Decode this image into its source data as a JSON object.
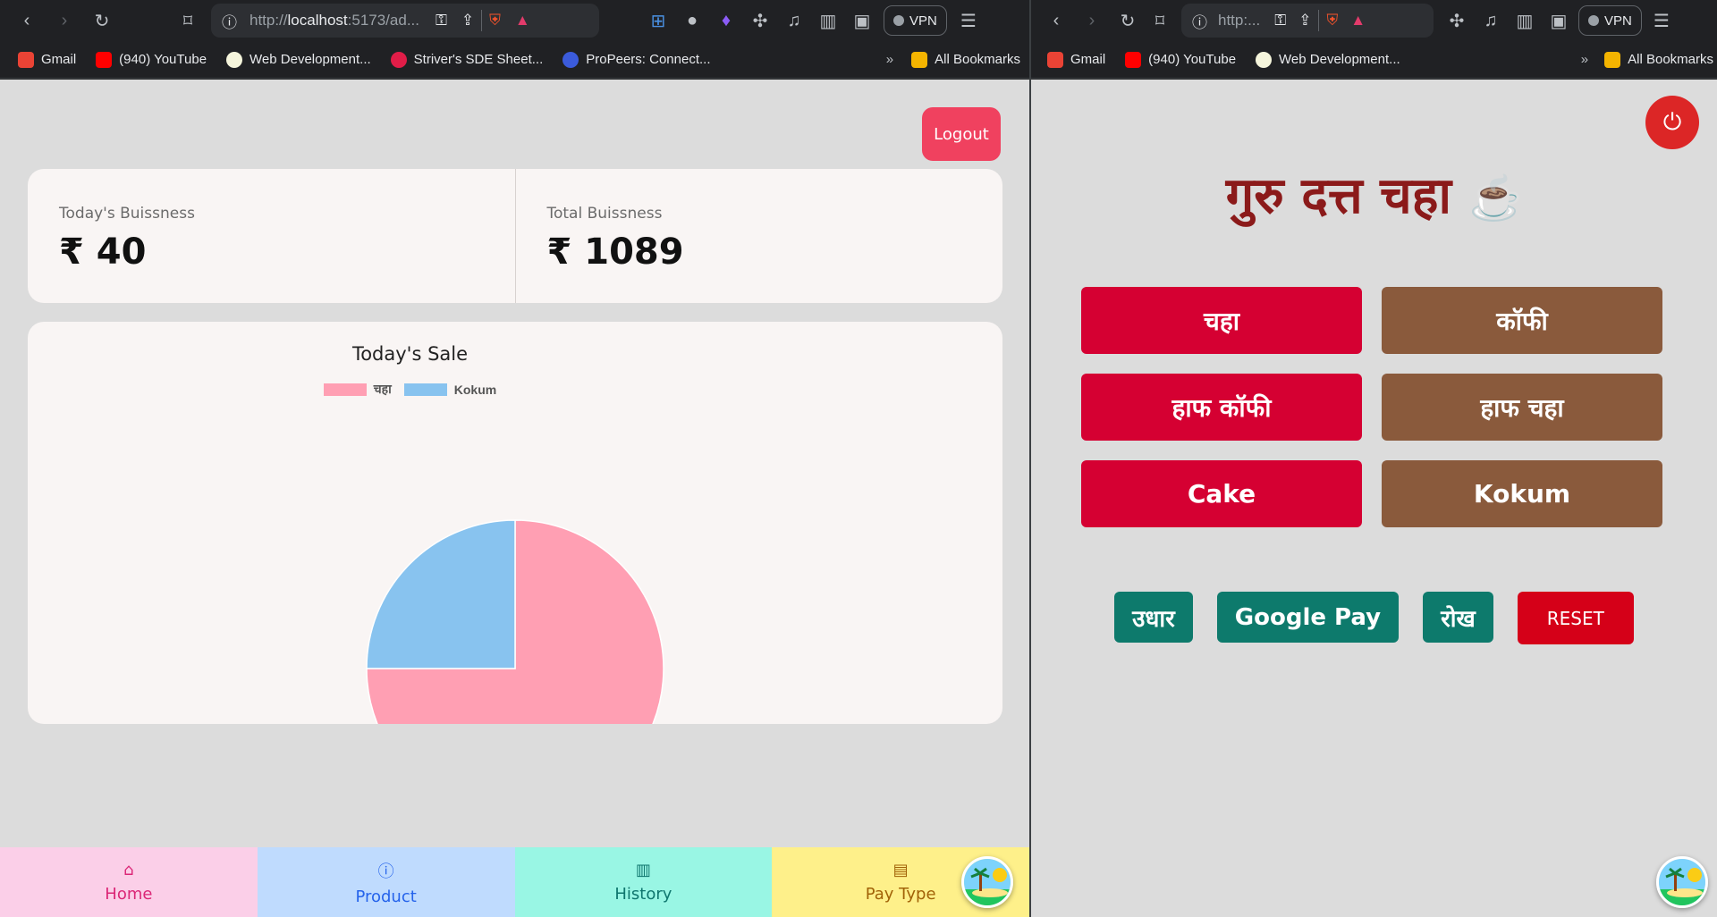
{
  "left_browser": {
    "url_prefix": "http://",
    "url_host": "localhost",
    "url_rest": ":5173/ad...",
    "vpn_label": "VPN",
    "bookmarks": [
      {
        "label": "Gmail",
        "icon": "gmail-icon"
      },
      {
        "label": "(940) YouTube",
        "icon": "youtube-icon"
      },
      {
        "label": "Web Development...",
        "icon": "web-dev-icon"
      },
      {
        "label": "Striver's SDE Sheet...",
        "icon": "tuf-icon"
      },
      {
        "label": "ProPeers: Connect...",
        "icon": "propeers-icon"
      }
    ],
    "overflow": "»",
    "all_bookmarks": "All Bookmarks"
  },
  "right_browser": {
    "url_text": "http:...",
    "vpn_label": "VPN",
    "bookmarks": [
      {
        "label": "Gmail",
        "icon": "gmail-icon"
      },
      {
        "label": "(940) YouTube",
        "icon": "youtube-icon"
      },
      {
        "label": "Web Development...",
        "icon": "web-dev-icon"
      }
    ],
    "overflow": "»",
    "all_bookmarks": "All Bookmarks"
  },
  "admin": {
    "logout_label": "Logout",
    "today_label": "Today's Buissness",
    "today_value": "₹ 40",
    "total_label": "Total Buissness",
    "total_value": "₹ 1089",
    "nav": [
      {
        "label": "Home",
        "icon": "home-icon"
      },
      {
        "label": "Product",
        "icon": "info-icon"
      },
      {
        "label": "History",
        "icon": "bar-chart-icon"
      },
      {
        "label": "Pay Type",
        "icon": "money-icon"
      }
    ]
  },
  "chart_data": {
    "type": "pie",
    "title": "Today's Sale",
    "legend_position": "top",
    "categories": [
      "चहा",
      "Kokum"
    ],
    "values": [
      30,
      10
    ],
    "colors": [
      "#ff9fb3",
      "#88c3ef"
    ]
  },
  "pos": {
    "brand_title": "गुरु दत्त चहा",
    "brand_icon": "☕",
    "items": [
      {
        "label": "चहा",
        "color": "red"
      },
      {
        "label": "कॉफी",
        "color": "brown"
      },
      {
        "label": "हाफ कॉफी",
        "color": "red"
      },
      {
        "label": "हाफ चहा",
        "color": "brown"
      },
      {
        "label": "Cake",
        "color": "red"
      },
      {
        "label": "Kokum",
        "color": "brown"
      }
    ],
    "payments": [
      {
        "label": "उधार"
      },
      {
        "label": "Google Pay"
      },
      {
        "label": "रोख"
      }
    ],
    "reset_label": "RESET"
  }
}
